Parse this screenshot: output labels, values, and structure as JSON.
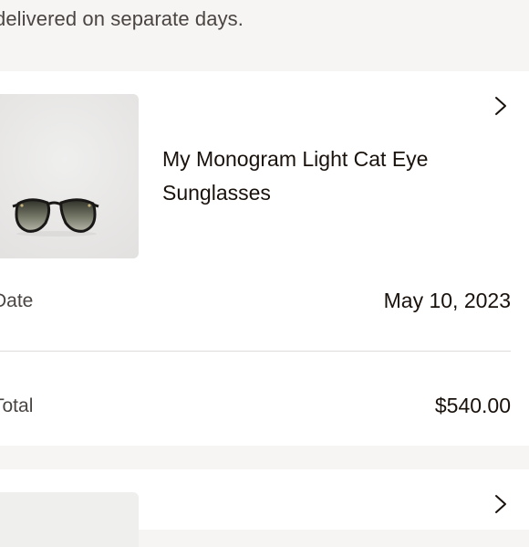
{
  "notice": {
    "text": "delivered on separate days."
  },
  "order_item": {
    "product_name": "My Monogram Light Cat Eye Sunglasses",
    "product_image_icon": "sunglasses-image",
    "chevron_icon": "chevron-right-icon",
    "date_label": "Date",
    "date_value": "May 10, 2023",
    "total_label": "Total",
    "total_value": "$540.00"
  },
  "next_item": {
    "chevron_icon": "chevron-right-icon"
  }
}
